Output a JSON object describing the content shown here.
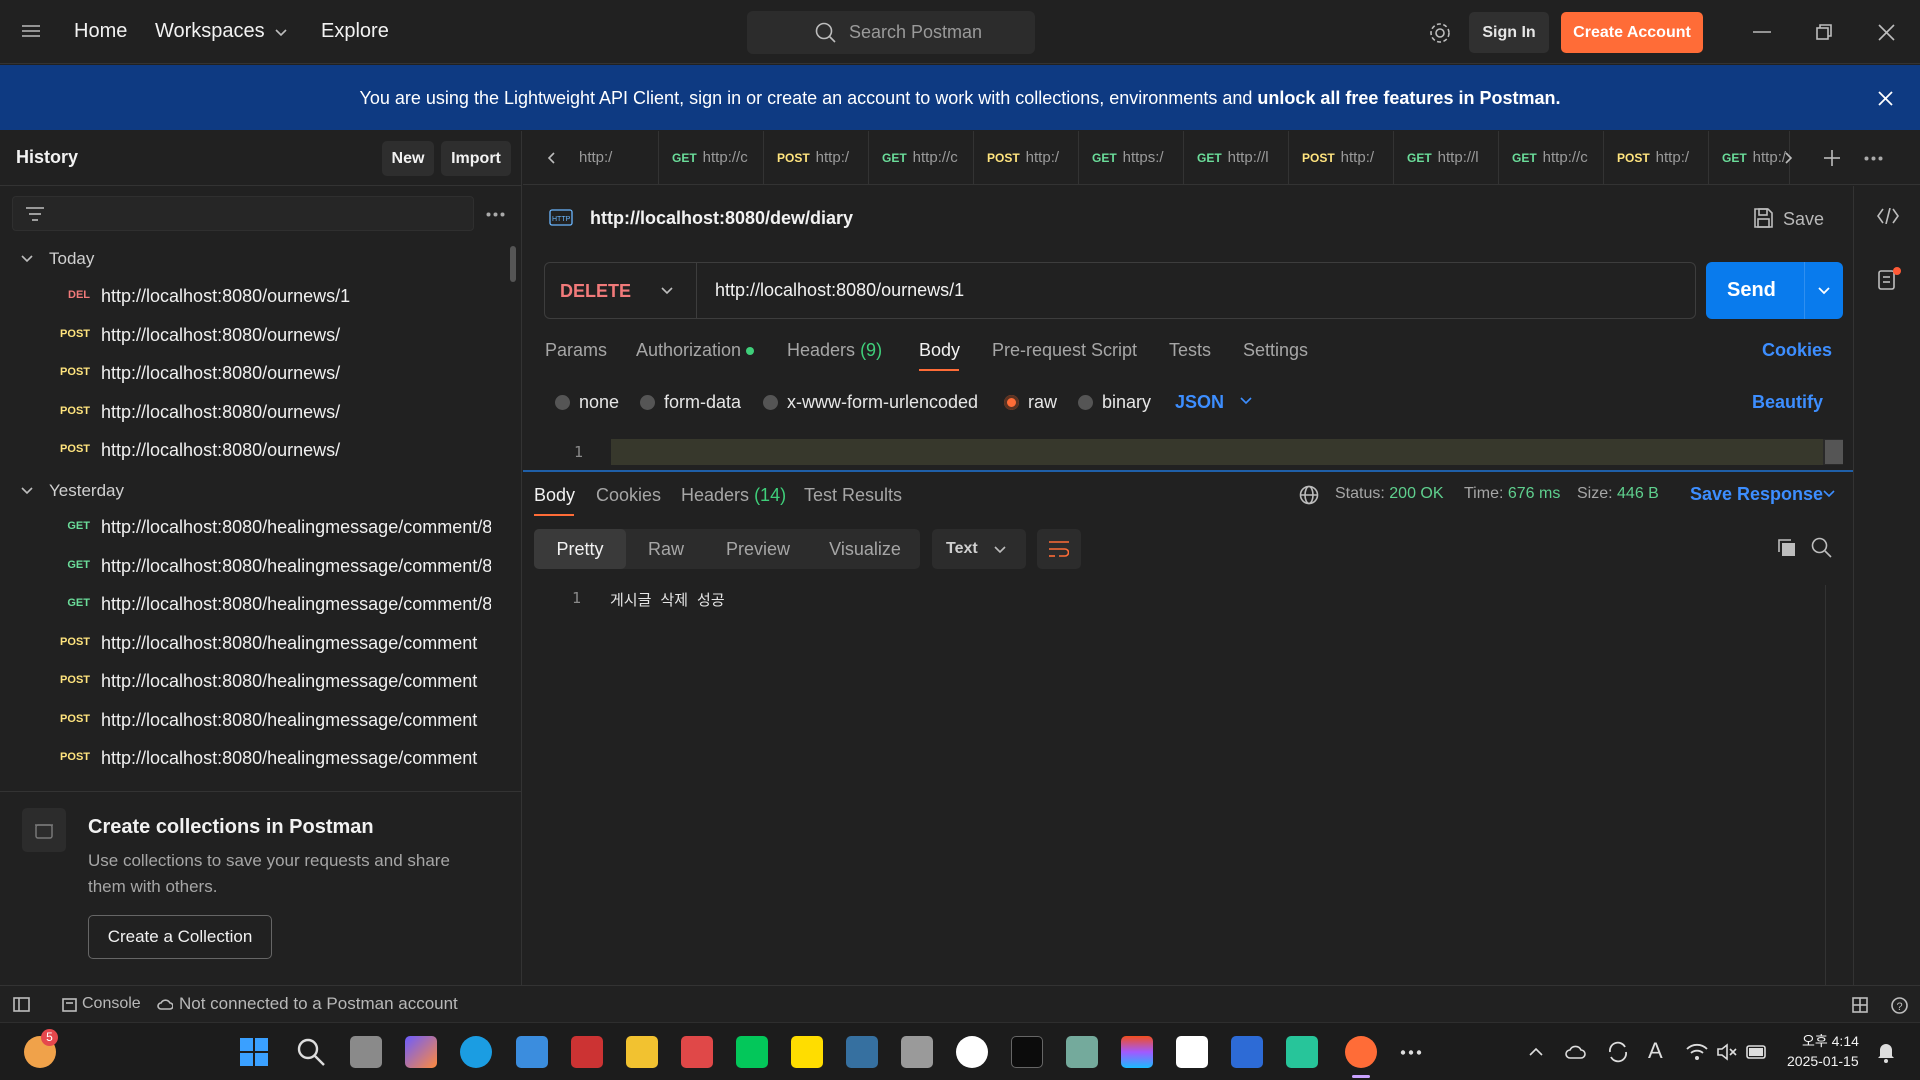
{
  "topbar": {
    "nav": [
      "Home",
      "Workspaces",
      "Explore"
    ],
    "search_placeholder": "Search Postman",
    "signin": "Sign In",
    "create_account": "Create Account"
  },
  "banner": {
    "text": "You are using the Lightweight API Client, sign in or create an account to work with collections, environments and ",
    "bold": "unlock all free features in Postman."
  },
  "sidebar": {
    "title": "History",
    "new_label": "New",
    "import_label": "Import",
    "groups": [
      {
        "label": "Today",
        "items": [
          {
            "method": "DEL",
            "url": "http://localhost:8080/ournews/1"
          },
          {
            "method": "POST",
            "url": "http://localhost:8080/ournews/"
          },
          {
            "method": "POST",
            "url": "http://localhost:8080/ournews/"
          },
          {
            "method": "POST",
            "url": "http://localhost:8080/ournews/"
          },
          {
            "method": "POST",
            "url": "http://localhost:8080/ournews/"
          }
        ]
      },
      {
        "label": "Yesterday",
        "items": [
          {
            "method": "GET",
            "url": "http://localhost:8080/healingmessage/comment/8"
          },
          {
            "method": "GET",
            "url": "http://localhost:8080/healingmessage/comment/8"
          },
          {
            "method": "GET",
            "url": "http://localhost:8080/healingmessage/comment/8"
          },
          {
            "method": "POST",
            "url": "http://localhost:8080/healingmessage/comment"
          },
          {
            "method": "POST",
            "url": "http://localhost:8080/healingmessage/comment"
          },
          {
            "method": "POST",
            "url": "http://localhost:8080/healingmessage/comment"
          },
          {
            "method": "POST",
            "url": "http://localhost:8080/healingmessage/comment"
          }
        ]
      }
    ],
    "promo": {
      "title": "Create collections in Postman",
      "desc": "Use collections to save your requests and share them with others.",
      "button": "Create a Collection"
    }
  },
  "tabs": [
    {
      "method": "",
      "url": "http:/"
    },
    {
      "method": "GET",
      "url": "http://c"
    },
    {
      "method": "POST",
      "url": "http:/"
    },
    {
      "method": "GET",
      "url": "http://c"
    },
    {
      "method": "POST",
      "url": "http:/"
    },
    {
      "method": "GET",
      "url": "https:/"
    },
    {
      "method": "GET",
      "url": "http://l"
    },
    {
      "method": "POST",
      "url": "http:/"
    },
    {
      "method": "GET",
      "url": "http://l"
    },
    {
      "method": "GET",
      "url": "http://c"
    },
    {
      "method": "POST",
      "url": "http:/"
    },
    {
      "method": "GET",
      "url": "http:/"
    }
  ],
  "request": {
    "title": "http://localhost:8080/dew/diary",
    "save_label": "Save",
    "method": "DELETE",
    "url": "http://localhost:8080/ournews/1",
    "send_label": "Send",
    "tabs": [
      "Params",
      "Authorization",
      "Headers",
      "(9)",
      "Body",
      "Pre-request Script",
      "Tests",
      "Settings"
    ],
    "cookies_label": "Cookies",
    "body_types": [
      "none",
      "form-data",
      "x-www-form-urlencoded",
      "raw",
      "binary"
    ],
    "body_format": "JSON",
    "beautify": "Beautify",
    "editor_line": "1"
  },
  "response": {
    "tabs": [
      "Body",
      "Cookies",
      "Headers",
      "(14)",
      "Test Results"
    ],
    "status_label": "Status:",
    "status_value": "200 OK",
    "time_label": "Time:",
    "time_value": "676 ms",
    "size_label": "Size:",
    "size_value": "446 B",
    "save_response": "Save Response",
    "formats": [
      "Pretty",
      "Raw",
      "Preview",
      "Visualize"
    ],
    "text_select": "Text",
    "line_no": "1",
    "body": "게시글 삭제 성공"
  },
  "statusbar": {
    "console": "Console",
    "connection": "Not connected to a Postman account"
  },
  "taskbar": {
    "weather_badge": "5",
    "time": "오후 4:14",
    "date": "2025-01-15"
  },
  "colors": {
    "accent_orange": "#ff6c37",
    "send_blue": "#097bed",
    "link_blue": "#3d8eff",
    "banner": "#0e3a82"
  }
}
